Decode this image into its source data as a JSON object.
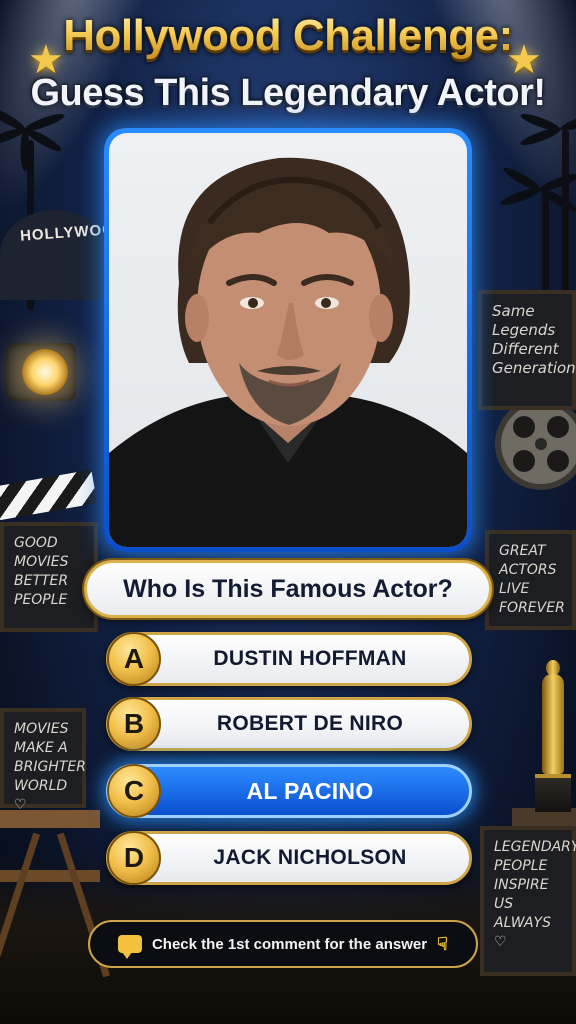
{
  "title": {
    "line1": "Hollywood Challenge:",
    "line2": "Guess This Legendary Actor!"
  },
  "scene": {
    "hollywood_sign": "HOLLYWOOD",
    "board_top_right": "Same Legends Different Generations",
    "board_left_1": "GOOD MOVIES BETTER PEOPLE",
    "board_left_2": "MOVIES MAKE A BRIGHTER WORLD ♡",
    "board_right_1": "GREAT ACTORS LIVE FOREVER",
    "board_right_2": "LEGENDARY PEOPLE INSPIRE US ALWAYS ♡"
  },
  "quiz": {
    "question": "Who Is This Famous Actor?",
    "options": [
      {
        "letter": "A",
        "text": "DUSTIN HOFFMAN",
        "selected": false
      },
      {
        "letter": "B",
        "text": "ROBERT DE NIRO",
        "selected": false
      },
      {
        "letter": "C",
        "text": "AL PACINO",
        "selected": true
      },
      {
        "letter": "D",
        "text": "JACK NICHOLSON",
        "selected": false
      }
    ]
  },
  "footer": {
    "text": "Check the 1st comment for the answer",
    "icon_left": "speech-bubble-icon",
    "icon_right": "pointing-down-icon"
  },
  "colors": {
    "accent_gold": "#f2c14d",
    "accent_blue": "#1f7bff",
    "background": "#13244a"
  }
}
